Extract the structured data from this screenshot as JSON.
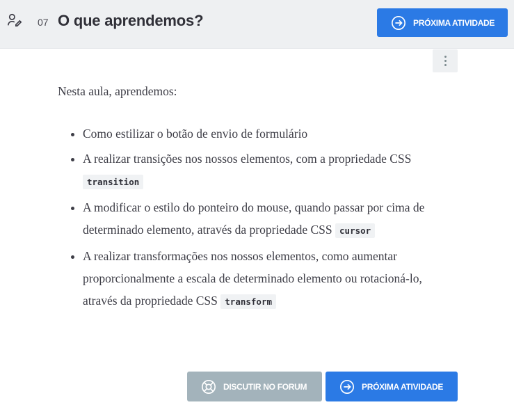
{
  "header": {
    "lesson_number": "07",
    "title": "O que aprendemos?",
    "next_button_label": "PRÓXIMA ATIVIDADE"
  },
  "content": {
    "intro": "Nesta aula, aprendemos:",
    "items": [
      {
        "text": "Como estilizar o botão de envio de formulário",
        "code": ""
      },
      {
        "text": "A realizar transições nos nossos elementos, com a propriedade CSS ",
        "code": "transition"
      },
      {
        "text": "A modificar o estilo do ponteiro do mouse, quando passar por cima de determinado elemento, através da propriedade CSS ",
        "code": "cursor"
      },
      {
        "text": "A realizar transformações nos nossos elementos, como aumentar proporcionalmente a escala de determinado elemento ou rotacioná-lo, através da propriedade CSS ",
        "code": "transform"
      }
    ]
  },
  "footer": {
    "forum_button_label": "DISCUTIR NO FORUM",
    "next_button_label": "PRÓXIMA ATIVIDADE"
  },
  "colors": {
    "header_bg": "#eef0f2",
    "primary": "#2b7ae5",
    "forum_button": "#a3b3bb"
  },
  "icons": {
    "header": "user-edit-icon",
    "next": "arrow-circle-right-icon",
    "forum": "lifebuoy-icon",
    "menu": "kebab-menu-icon"
  }
}
